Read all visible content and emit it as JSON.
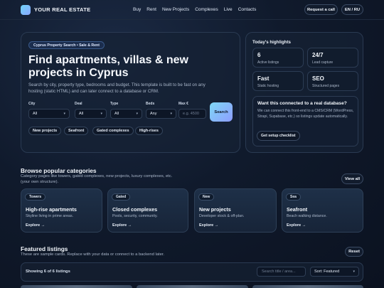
{
  "header": {
    "brand": "YOUR REAL ESTATE",
    "nav": [
      "Buy",
      "Rent",
      "New Projects",
      "Complexes",
      "Live",
      "Contacts"
    ],
    "request_call": "Request a call",
    "lang": "EN / RU"
  },
  "hero": {
    "badge": "Cyprus Property Search • Sale & Rent",
    "title": "Find apartments, villas & new projects in Cyprus",
    "description": "Search by city, property type, bedrooms and budget. This template is built to be fast on any hosting (static HTML) and can later connect to a database or CRM.",
    "filters": {
      "city": {
        "label": "City",
        "value": "All"
      },
      "deal": {
        "label": "Deal",
        "value": "All"
      },
      "type": {
        "label": "Type",
        "value": "All"
      },
      "beds": {
        "label": "Beds",
        "value": "Any"
      },
      "max": {
        "label": "Max €",
        "placeholder": "e.g. 4500"
      }
    },
    "search_button": "Search",
    "chips": [
      "New projects",
      "Seafront",
      "Gated complexes",
      "High-rises"
    ]
  },
  "highlights": {
    "title": "Today's highlights",
    "tiles": [
      {
        "value": "6",
        "label": "Active listings"
      },
      {
        "value": "24/7",
        "label": "Lead capture"
      },
      {
        "value": "Fast",
        "label": "Static hosting"
      },
      {
        "value": "SEO",
        "label": "Structured pages"
      }
    ],
    "cta": {
      "title": "Want this connected to a real database?",
      "description": "We can connect this front-end to a CMS/CRM (WordPress, Strapi, Supabase, etc.) so listings update automatically.",
      "button": "Get setup checklist"
    }
  },
  "categories": {
    "title": "Browse popular categories",
    "description": "Category pages like towers, gated complexes, new projects, luxury complexes, etc. (your own structure).",
    "view_all": "View all",
    "cards": [
      {
        "tag": "Towers",
        "title": "High-rise apartments",
        "desc": "Skyline living in prime areas.",
        "link": "Explore →"
      },
      {
        "tag": "Gated",
        "title": "Closed complexes",
        "desc": "Pools, security, community.",
        "link": "Explore →"
      },
      {
        "tag": "New",
        "title": "New projects",
        "desc": "Developer stock & off-plan.",
        "link": "Explore →"
      },
      {
        "tag": "Sea",
        "title": "Seafront",
        "desc": "Beach walking distance.",
        "link": "Explore →"
      }
    ]
  },
  "featured": {
    "title": "Featured listings",
    "description": "These are sample cards. Replace with your data or connect to a backend later.",
    "reset": "Reset",
    "showing": "Showing 6 of 6 listings",
    "search_placeholder": "Search title / area...",
    "sort": "Sort: Featured"
  }
}
